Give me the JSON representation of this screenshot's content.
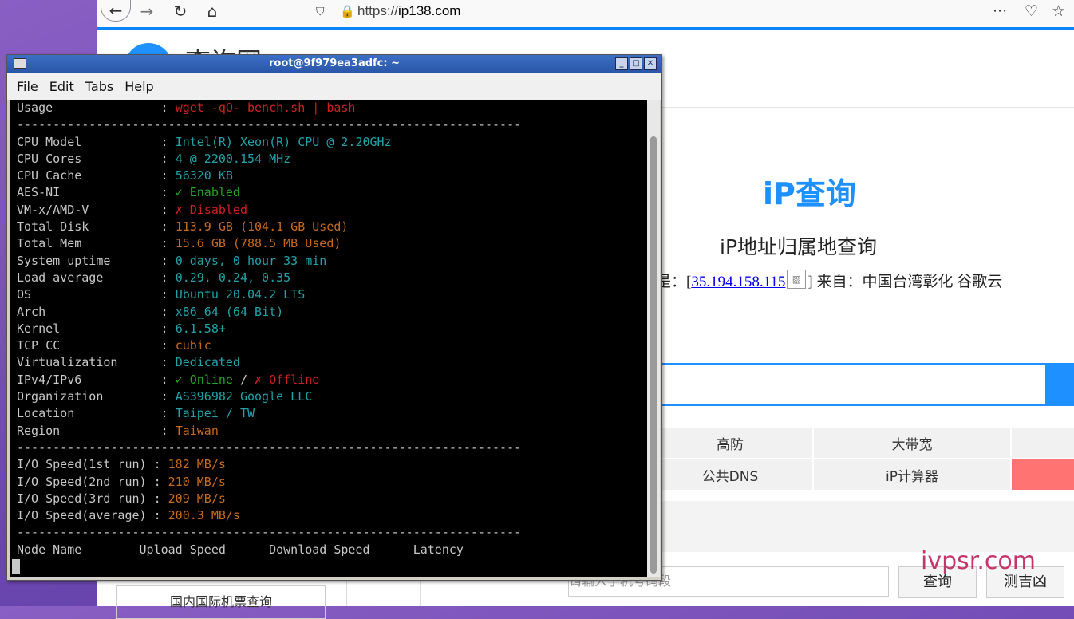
{
  "browser": {
    "url_prefix": "https://",
    "url_domain": "ip138.com",
    "icons": [
      "back-arrow-icon",
      "forward-arrow-icon",
      "reload-icon",
      "home-icon",
      "tracking-shield-icon",
      "lock-icon",
      "more-icon",
      "pocket-icon",
      "star-icon"
    ]
  },
  "site": {
    "logo_text": "查询网",
    "hero_title": "iP查询",
    "hero_subtitle": "iP地址归属地查询",
    "ip_prefix": "是：[",
    "ip_address": "35.194.158.115",
    "ip_suffix": "] 来自：中国台湾彰化 谷歌云",
    "grid": [
      [
        "高防",
        "大带宽",
        ""
      ],
      [
        "公共DNS",
        "iP计算器",
        ""
      ]
    ],
    "flight_button": "国内国际机票查询",
    "phone_placeholder": "请输入手机号码段",
    "query_button": "查询",
    "luck_button": "测吉凶",
    "watermark": "ivpsr.com",
    "colors": {
      "accent": "#1e90ff",
      "red_tile": "#ff7373"
    }
  },
  "terminal": {
    "title": "root@9f979ea3adfc: ~",
    "menu": [
      "File",
      "Edit",
      "Tabs",
      "Help"
    ],
    "separator": "----------------------------------------------------------------------",
    "info": [
      {
        "key": "Usage               ",
        "value": "wget -qO- bench.sh | bash",
        "color": "red"
      },
      {
        "key": "CPU Model           ",
        "value": "Intel(R) Xeon(R) CPU @ 2.20GHz",
        "color": "cyan"
      },
      {
        "key": "CPU Cores           ",
        "value": "4 @ 2200.154 MHz",
        "color": "cyan"
      },
      {
        "key": "CPU Cache           ",
        "value": "56320 KB",
        "color": "cyan"
      },
      {
        "key": "AES-NI              ",
        "value": "✓ Enabled",
        "color": "green"
      },
      {
        "key": "VM-x/AMD-V          ",
        "value": "✗ Disabled",
        "color": "red"
      },
      {
        "key": "Total Disk          ",
        "value": "113.9 GB (104.1 GB Used)",
        "color": "orange"
      },
      {
        "key": "Total Mem           ",
        "value": "15.6 GB (788.5 MB Used)",
        "color": "orange"
      },
      {
        "key": "System uptime       ",
        "value": "0 days, 0 hour 33 min",
        "color": "cyan"
      },
      {
        "key": "Load average        ",
        "value": "0.29, 0.24, 0.35",
        "color": "cyan"
      },
      {
        "key": "OS                  ",
        "value": "Ubuntu 20.04.2 LTS",
        "color": "cyan"
      },
      {
        "key": "Arch                ",
        "value": "x86_64 (64 Bit)",
        "color": "cyan"
      },
      {
        "key": "Kernel              ",
        "value": "6.1.58+",
        "color": "cyan"
      },
      {
        "key": "TCP CC              ",
        "value": "cubic",
        "color": "orange"
      },
      {
        "key": "Virtualization      ",
        "value": "Dedicated",
        "color": "cyan"
      },
      {
        "key": "IPv4/IPv6           ",
        "value": "✓ Online",
        "value2": "✗ Offline",
        "color": "green"
      },
      {
        "key": "Organization        ",
        "value": "AS396982 Google LLC",
        "color": "cyan"
      },
      {
        "key": "Location            ",
        "value": "Taipei / TW",
        "color": "cyan"
      },
      {
        "key": "Region              ",
        "value": "Taiwan",
        "color": "orange"
      }
    ],
    "io": [
      {
        "key": "I/O Speed(1st run) ",
        "value": "182 MB/s"
      },
      {
        "key": "I/O Speed(2nd run) ",
        "value": "210 MB/s"
      },
      {
        "key": "I/O Speed(3rd run) ",
        "value": "209 MB/s"
      },
      {
        "key": "I/O Speed(average) ",
        "value": "200.3 MB/s"
      }
    ],
    "node_header": "Node Name        Upload Speed      Download Speed      Latency"
  }
}
